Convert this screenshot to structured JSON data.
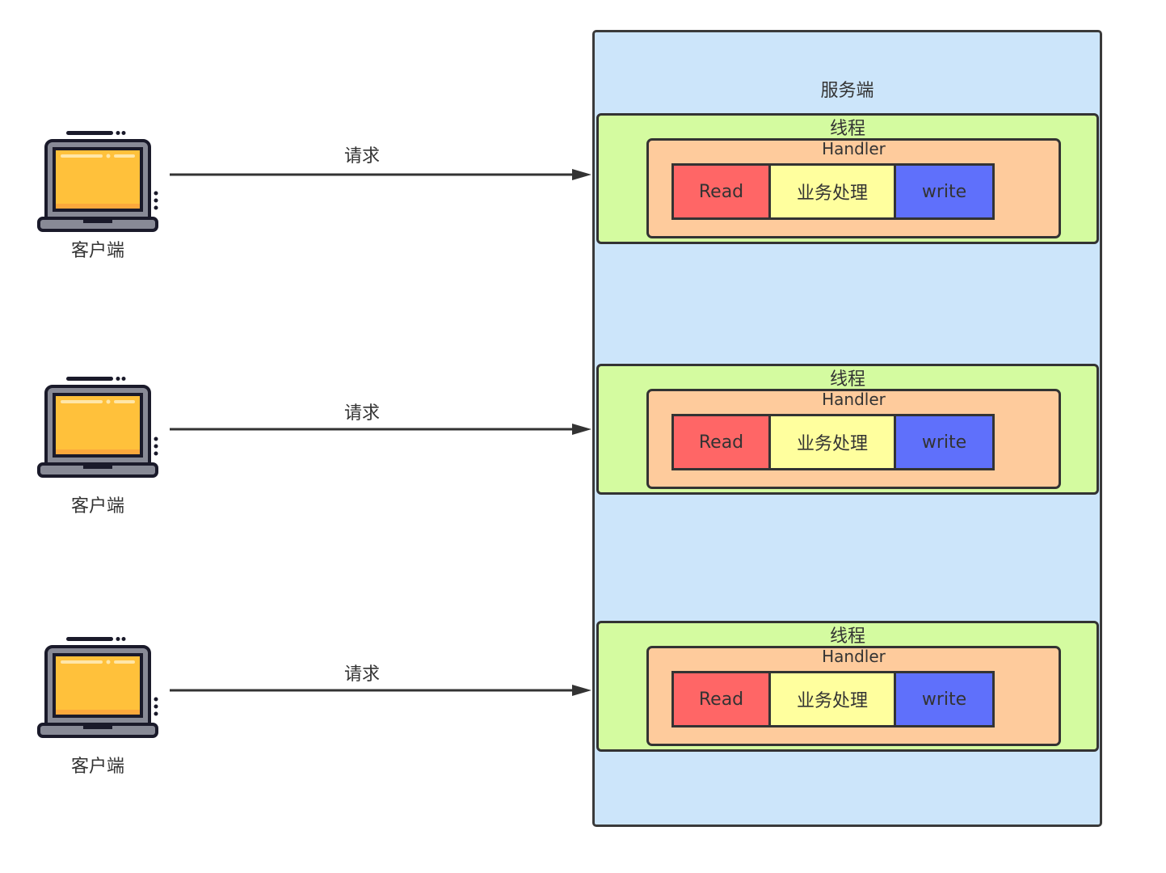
{
  "server": {
    "title": "服务端"
  },
  "rows": [
    {
      "client": "客户端",
      "request": "请求",
      "thread": "线程",
      "handler": "Handler",
      "steps": [
        "Read",
        "业务处理",
        "write"
      ]
    },
    {
      "client": "客户端",
      "request": "请求",
      "thread": "线程",
      "handler": "Handler",
      "steps": [
        "Read",
        "业务处理",
        "write"
      ]
    },
    {
      "client": "客户端",
      "request": "请求",
      "thread": "线程",
      "handler": "Handler",
      "steps": [
        "Read",
        "业务处理",
        "write"
      ]
    }
  ],
  "colors": {
    "server_bg": "#cce5fa",
    "thread_bg": "#d4fba0",
    "handler_bg": "#fecb9c",
    "read": "#ff6666",
    "business": "#ffff9e",
    "write": "#5f70fb",
    "screen": "#ffc13b"
  }
}
